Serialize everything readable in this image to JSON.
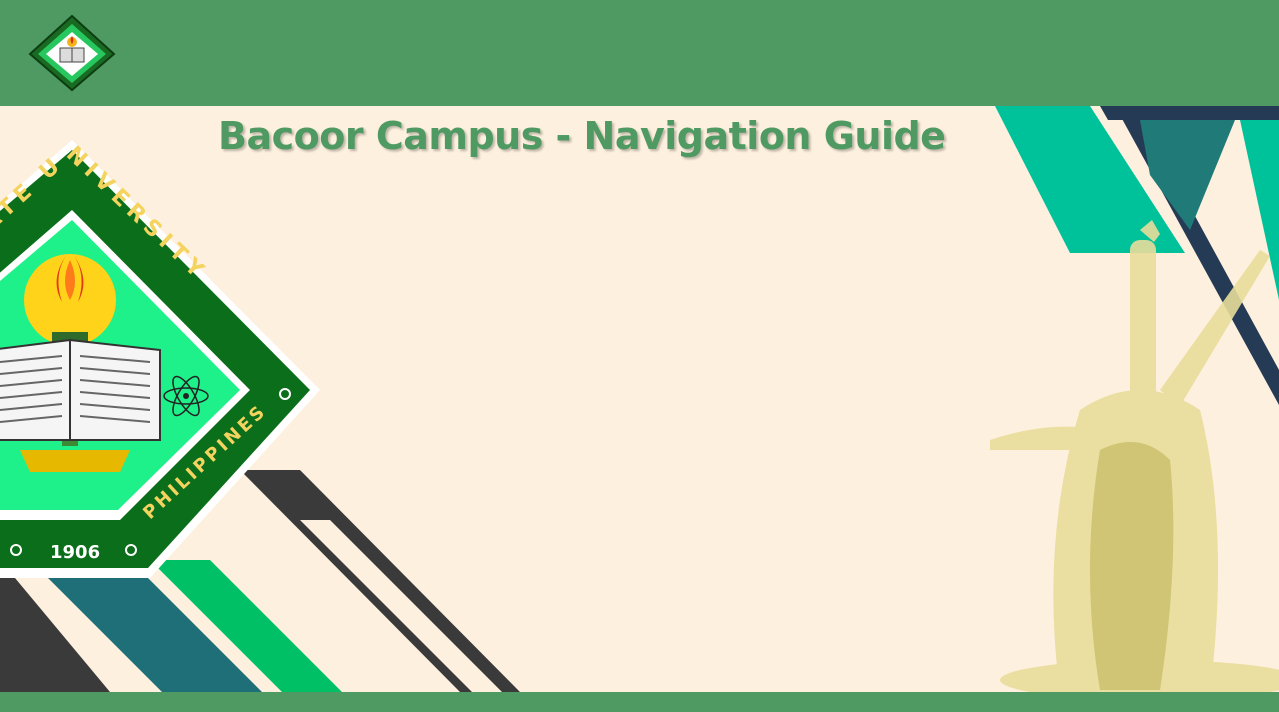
{
  "header": {
    "logo_icon": "university-seal-icon"
  },
  "main": {
    "title": "Bacoor Campus - Navigation Guide"
  },
  "seal": {
    "ring_text_top": "STATE UNIVERSITY",
    "ring_text_bottom": "PHILIPPINES",
    "year": "1906"
  },
  "colors": {
    "primary_green": "#4e9a62",
    "background": "#fdf0de",
    "teal": "#00c29a",
    "dark_teal": "#1f7a78",
    "navy": "#253a55",
    "charcoal": "#3a3a3a",
    "bright_green": "#00c065"
  }
}
